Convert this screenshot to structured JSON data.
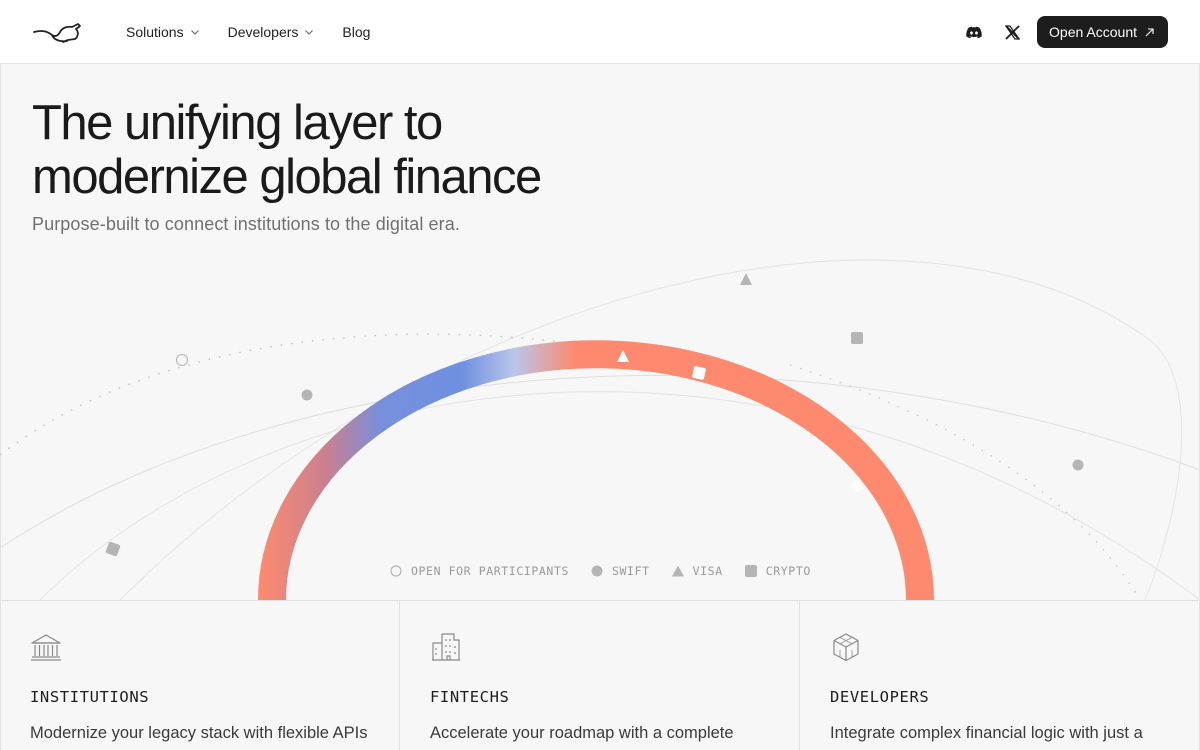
{
  "nav": {
    "logo_icon": "kangaroo-logo-icon",
    "links": [
      {
        "label": "Solutions",
        "has_dropdown": true
      },
      {
        "label": "Developers",
        "has_dropdown": true
      },
      {
        "label": "Blog",
        "has_dropdown": false
      }
    ],
    "social_icons": [
      "discord-icon",
      "x-icon"
    ],
    "cta_label": "Open Account",
    "cta_icon": "arrow-up-right-icon"
  },
  "hero": {
    "title_line1": "The unifying layer to",
    "title_line2": "modernize global finance",
    "subtitle": "Purpose-built to connect institutions to the digital era."
  },
  "legend": [
    {
      "marker": "circle-outline",
      "label": "OPEN FOR PARTICIPANTS"
    },
    {
      "marker": "circle-filled",
      "label": "SWIFT"
    },
    {
      "marker": "triangle",
      "label": "VISA"
    },
    {
      "marker": "square",
      "label": "CRYPTO"
    }
  ],
  "colors": {
    "ring_coral": "#fd8a6e",
    "ring_blue": "#6f8fe0",
    "ring_pale": "#b9c6ea",
    "button_dark": "#1d1d1d",
    "node_gray": "#b8b8b8"
  },
  "cards": [
    {
      "icon": "bank-icon",
      "title": "INSTITUTIONS",
      "desc": "Modernize your legacy stack with flexible APIs designed to handle high-volume"
    },
    {
      "icon": "buildings-icon",
      "title": "FINTECHS",
      "desc": "Accelerate your roadmap with a complete suite of payment tools, banking rails and"
    },
    {
      "icon": "cube-icon",
      "title": "DEVELOPERS",
      "desc": "Integrate complex financial logic with just a few lines of code. An expressive ledger layer"
    }
  ]
}
